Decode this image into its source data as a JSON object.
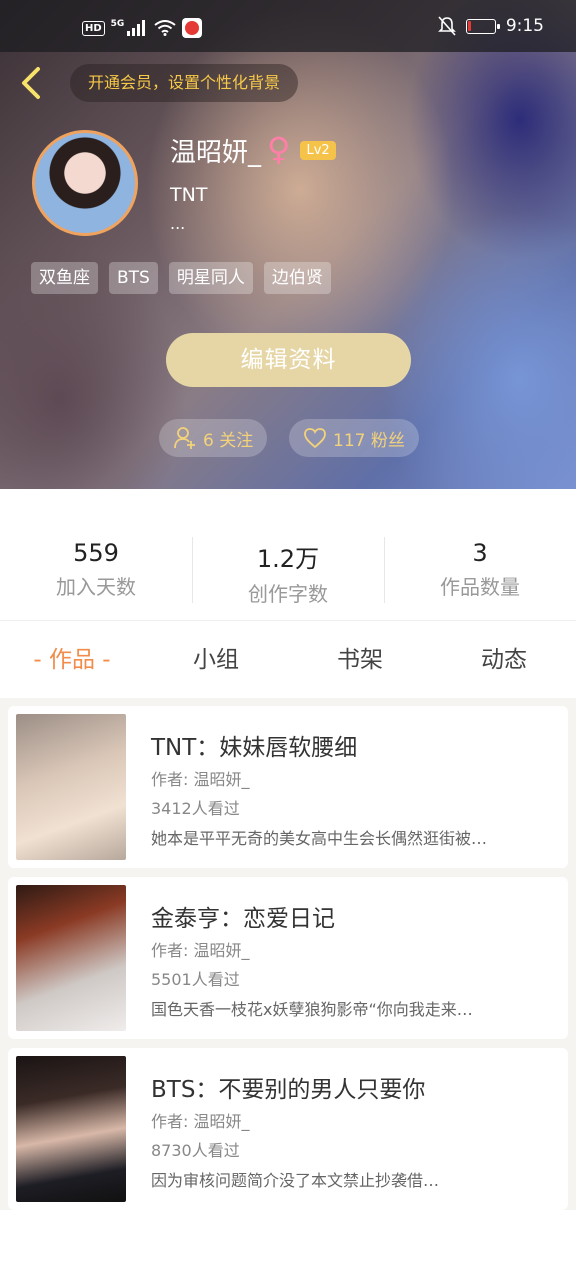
{
  "status_bar": {
    "time": "9:15",
    "hd": "HD",
    "network": "5G",
    "battery_level": 0.12
  },
  "header": {
    "member_prompt": "开通会员，设置个性化背景",
    "username": "温昭妍_",
    "gender_symbol": "♀",
    "level": "Lv2",
    "bio": "TNT",
    "bio_more": "...",
    "tags": [
      "双鱼座",
      "BTS",
      "明星同人",
      "边伯贤"
    ],
    "edit_label": "编辑资料",
    "following": "6 关注",
    "fans": "117 粉丝"
  },
  "stats": [
    {
      "value": "559",
      "label": "加入天数"
    },
    {
      "value": "1.2万",
      "label": "创作字数"
    },
    {
      "value": "3",
      "label": "作品数量"
    }
  ],
  "tabs": [
    {
      "label": "- 作品 -",
      "active": true
    },
    {
      "label": "小组",
      "active": false
    },
    {
      "label": "书架",
      "active": false
    },
    {
      "label": "动态",
      "active": false
    }
  ],
  "works": [
    {
      "title": "TNT：妹妹唇软腰细",
      "author": "作者: 温昭妍_",
      "views": "3412人看过",
      "description": "她本是平平无奇的美女高中生会长偶然逛街被…"
    },
    {
      "title": "金泰亨：恋爱日记",
      "author": "作者: 温昭妍_",
      "views": "5501人看过",
      "description": "国色天香一枝花x妖孽狼狗影帝“你向我走来…"
    },
    {
      "title": "BTS：不要别的男人只要你",
      "author": "作者: 温昭妍_",
      "views": "8730人看过",
      "description": "因为审核问题简介没了本文禁止抄袭借…"
    }
  ],
  "colors": {
    "accent": "#f28c4a",
    "gold": "#f7c948",
    "edit_button": "#e6d6a6",
    "level_badge": "#f6c34a"
  }
}
